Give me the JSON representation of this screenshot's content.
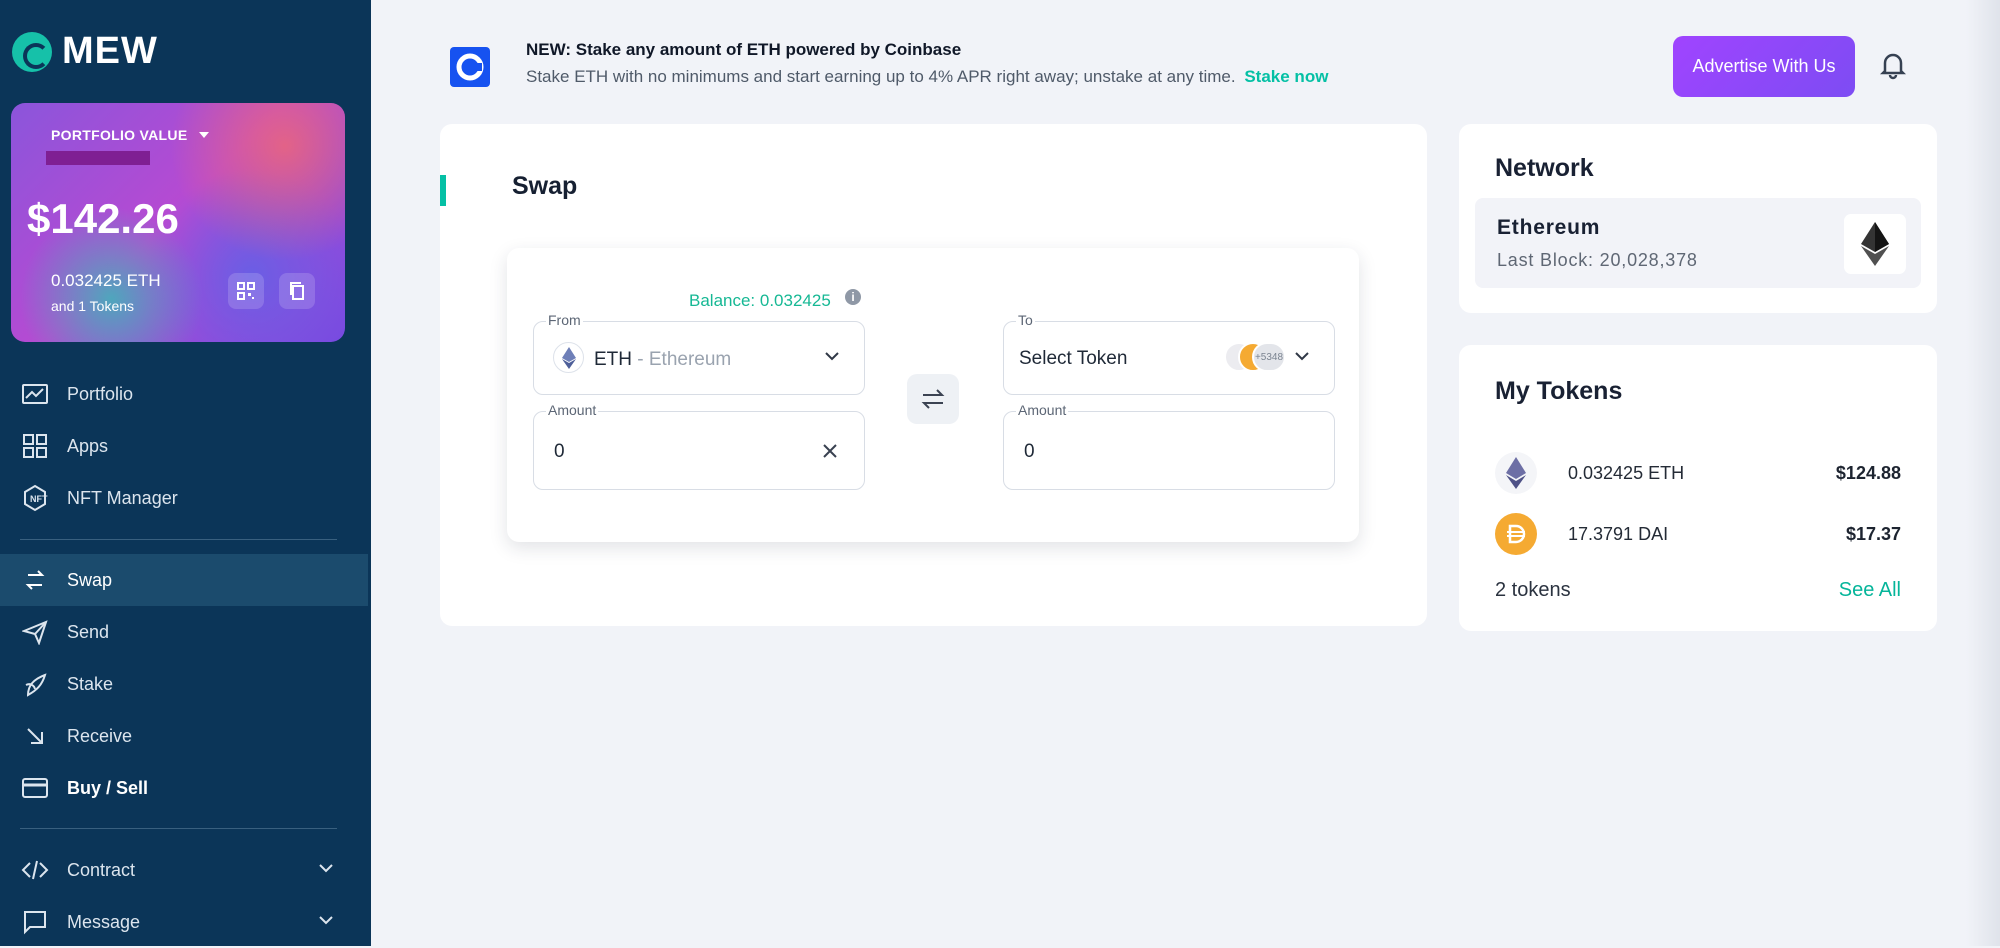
{
  "brand": {
    "name": "MEW"
  },
  "portfolio": {
    "label": "PORTFOLIO VALUE",
    "value": "$142.26",
    "eth_balance": "0.032425 ETH",
    "tokens_text": "and 1 Tokens"
  },
  "sidebar": {
    "items": [
      {
        "label": "Portfolio",
        "icon": "chart-icon"
      },
      {
        "label": "Apps",
        "icon": "apps-grid-icon"
      },
      {
        "label": "NFT Manager",
        "icon": "nft-icon"
      },
      {
        "label": "Swap",
        "icon": "swap-icon",
        "active": true
      },
      {
        "label": "Send",
        "icon": "send-icon"
      },
      {
        "label": "Stake",
        "icon": "stake-icon"
      },
      {
        "label": "Receive",
        "icon": "receive-icon"
      },
      {
        "label": "Buy / Sell",
        "icon": "card-icon"
      },
      {
        "label": "Contract",
        "icon": "code-icon"
      },
      {
        "label": "Message",
        "icon": "message-icon"
      }
    ]
  },
  "banner": {
    "title": "NEW: Stake any amount of ETH powered by Coinbase",
    "text": "Stake ETH with no minimums and start earning up to 4% APR right away; unstake at any time.",
    "link": "Stake now"
  },
  "header": {
    "advertise_button": "Advertise With Us"
  },
  "swap": {
    "title": "Swap",
    "balance": "Balance: 0.032425",
    "info_icon": "i",
    "from_label": "From",
    "from_symbol": "ETH",
    "from_name": " - Ethereum",
    "amount_label": "Amount",
    "from_amount": "0",
    "to_label": "To",
    "to_placeholder": "Select Token",
    "to_amount": "0",
    "token_stack_count": "+5348"
  },
  "network": {
    "title": "Network",
    "name": "Ethereum",
    "last_block": "Last Block: 20,028,378"
  },
  "tokens": {
    "title": "My Tokens",
    "items": [
      {
        "amount": "0.032425 ETH",
        "usd": "$124.88",
        "icon": "eth-icon"
      },
      {
        "amount": "17.3791 DAI",
        "usd": "$17.37",
        "icon": "dai-icon"
      }
    ],
    "count": "2 tokens",
    "see_all": "See All"
  },
  "colors": {
    "sidebar": "#0b3558",
    "accent": "#05c0a5",
    "advertise": "#8f48f5",
    "coinbase": "#1652f0",
    "dai": "#f5aa32"
  }
}
